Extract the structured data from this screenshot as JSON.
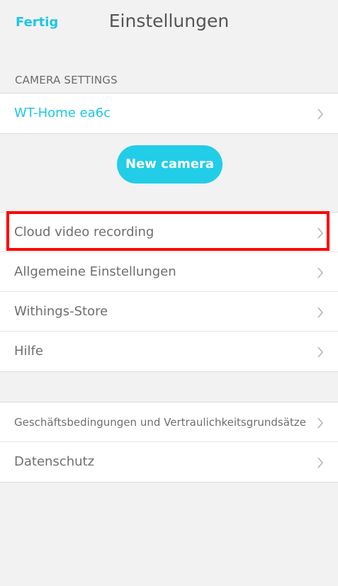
{
  "header": {
    "done_label": "Fertig",
    "title": "Einstellungen"
  },
  "camera_settings": {
    "section_title": "CAMERA SETTINGS",
    "camera_name": "WT-Home ea6c",
    "new_camera_label": "New camera"
  },
  "menu": {
    "items": [
      {
        "label": "Cloud video recording"
      },
      {
        "label": "Allgemeine Einstellungen"
      },
      {
        "label": "Withings-Store"
      },
      {
        "label": "Hilfe"
      }
    ]
  },
  "legal": {
    "items": [
      {
        "label": "Geschäftsbedingungen und Vertraulichkeitsgrundsätze"
      },
      {
        "label": "Datenschutz"
      }
    ]
  },
  "colors": {
    "accent": "#1ec6e6",
    "highlight": "#ff0000",
    "background": "#f2f2f2"
  }
}
